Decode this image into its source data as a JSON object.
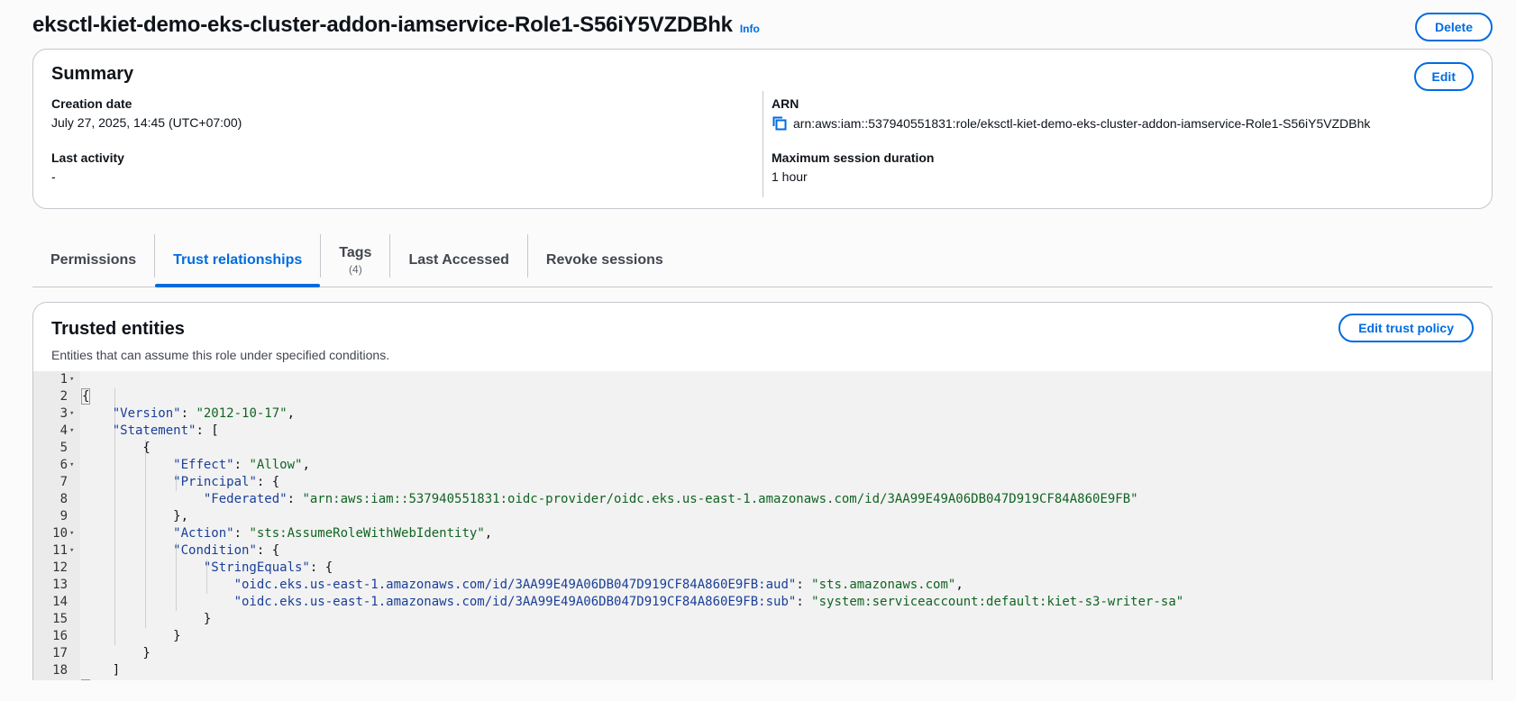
{
  "header": {
    "title": "eksctl-kiet-demo-eks-cluster-addon-iamservice-Role1-S56iY5VZDBhk",
    "info_label": "Info",
    "delete_label": "Delete"
  },
  "summary": {
    "title": "Summary",
    "edit_label": "Edit",
    "creation_date_label": "Creation date",
    "creation_date_value": "July 27, 2025, 14:45 (UTC+07:00)",
    "last_activity_label": "Last activity",
    "last_activity_value": "-",
    "arn_label": "ARN",
    "arn_value": "arn:aws:iam::537940551831:role/eksctl-kiet-demo-eks-cluster-addon-iamservice-Role1-S56iY5VZDBhk",
    "max_session_label": "Maximum session duration",
    "max_session_value": "1 hour"
  },
  "tabs": [
    {
      "label": "Permissions"
    },
    {
      "label": "Trust relationships"
    },
    {
      "label": "Tags",
      "sub": "(4)"
    },
    {
      "label": "Last Accessed"
    },
    {
      "label": "Revoke sessions"
    }
  ],
  "trusted": {
    "title": "Trusted entities",
    "description": "Entities that can assume this role under specified conditions.",
    "edit_label": "Edit trust policy"
  },
  "code_lines": [
    {
      "n": "1",
      "fold": true
    },
    {
      "n": "2",
      "fold": false
    },
    {
      "n": "3",
      "fold": true
    },
    {
      "n": "4",
      "fold": true
    },
    {
      "n": "5",
      "fold": false
    },
    {
      "n": "6",
      "fold": true
    },
    {
      "n": "7",
      "fold": false
    },
    {
      "n": "8",
      "fold": false
    },
    {
      "n": "9",
      "fold": false
    },
    {
      "n": "10",
      "fold": true
    },
    {
      "n": "11",
      "fold": true
    },
    {
      "n": "12",
      "fold": false
    },
    {
      "n": "13",
      "fold": false
    },
    {
      "n": "14",
      "fold": false
    },
    {
      "n": "15",
      "fold": false
    },
    {
      "n": "16",
      "fold": false
    },
    {
      "n": "17",
      "fold": false
    },
    {
      "n": "18",
      "fold": false
    }
  ],
  "policy": {
    "version_key": "\"Version\"",
    "version_val": "\"2012-10-17\"",
    "statement_key": "\"Statement\"",
    "effect_key": "\"Effect\"",
    "effect_val": "\"Allow\"",
    "principal_key": "\"Principal\"",
    "federated_key": "\"Federated\"",
    "federated_val": "\"arn:aws:iam::537940551831:oidc-provider/oidc.eks.us-east-1.amazonaws.com/id/3AA99E49A06DB047D919CF84A860E9FB\"",
    "action_key": "\"Action\"",
    "action_val": "\"sts:AssumeRoleWithWebIdentity\"",
    "condition_key": "\"Condition\"",
    "stringequals_key": "\"StringEquals\"",
    "aud_key": "\"oidc.eks.us-east-1.amazonaws.com/id/3AA99E49A06DB047D919CF84A860E9FB:aud\"",
    "aud_val": "\"sts.amazonaws.com\"",
    "sub_key": "\"oidc.eks.us-east-1.amazonaws.com/id/3AA99E49A06DB047D919CF84A860E9FB:sub\"",
    "sub_val": "\"system:serviceaccount:default:kiet-s3-writer-sa\""
  },
  "colors": {
    "accent": "#006ce0",
    "json_key": "#1a3f99",
    "json_string": "#116422"
  }
}
